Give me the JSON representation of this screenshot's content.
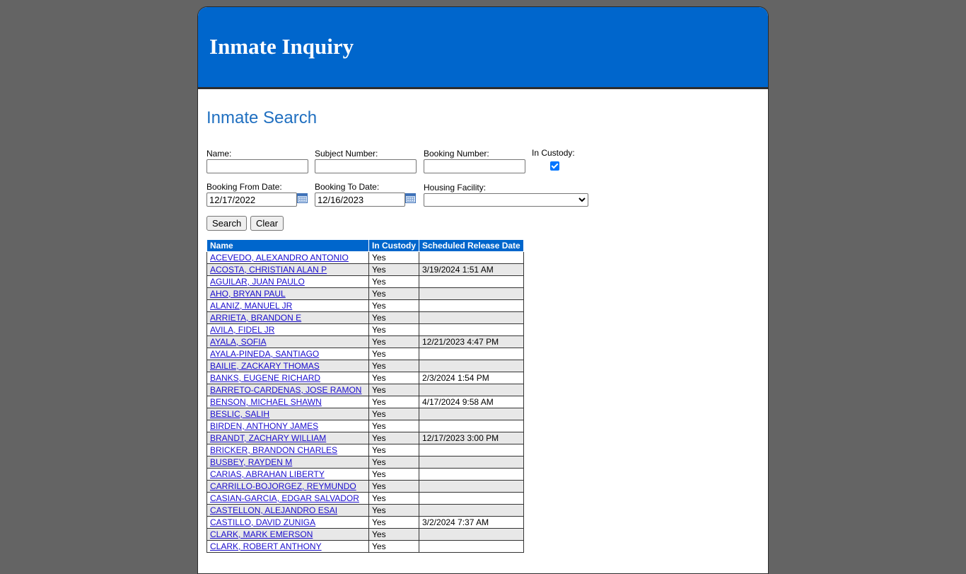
{
  "header": {
    "title": "Inmate Inquiry"
  },
  "page": {
    "title": "Inmate Search"
  },
  "form": {
    "name_label": "Name:",
    "name_value": "",
    "subject_label": "Subject Number:",
    "subject_value": "",
    "booking_label": "Booking Number:",
    "booking_value": "",
    "custody_label": "In Custody:",
    "custody_checked": true,
    "from_label": "Booking From Date:",
    "from_value": "12/17/2022",
    "to_label": "Booking To Date:",
    "to_value": "12/16/2023",
    "facility_label": "Housing Facility:",
    "facility_value": "",
    "search_button": "Search",
    "clear_button": "Clear"
  },
  "table": {
    "headers": [
      "Name",
      "In Custody",
      "Scheduled Release Date"
    ],
    "rows": [
      [
        "ACEVEDO, ALEXANDRO ANTONIO",
        "Yes",
        ""
      ],
      [
        "ACOSTA, CHRISTIAN ALAN P",
        "Yes",
        "3/19/2024 1:51 AM"
      ],
      [
        "AGUILAR, JUAN PAULO",
        "Yes",
        ""
      ],
      [
        "AHO, BRYAN PAUL",
        "Yes",
        ""
      ],
      [
        "ALANIZ, MANUEL JR",
        "Yes",
        ""
      ],
      [
        "ARRIETA, BRANDON E",
        "Yes",
        ""
      ],
      [
        "AVILA, FIDEL JR",
        "Yes",
        ""
      ],
      [
        "AYALA, SOFIA",
        "Yes",
        "12/21/2023 4:47 PM"
      ],
      [
        "AYALA-PINEDA, SANTIAGO",
        "Yes",
        ""
      ],
      [
        "BAILIE, ZACKARY THOMAS",
        "Yes",
        ""
      ],
      [
        "BANKS, EUGENE RICHARD",
        "Yes",
        "2/3/2024 1:54 PM"
      ],
      [
        "BARRETO-CARDENAS, JOSE RAMON",
        "Yes",
        ""
      ],
      [
        "BENSON, MICHAEL SHAWN",
        "Yes",
        "4/17/2024 9:58 AM"
      ],
      [
        "BESLIC, SALIH",
        "Yes",
        ""
      ],
      [
        "BIRDEN, ANTHONY JAMES",
        "Yes",
        ""
      ],
      [
        "BRANDT, ZACHARY WILLIAM",
        "Yes",
        "12/17/2023 3:00 PM"
      ],
      [
        "BRICKER, BRANDON CHARLES",
        "Yes",
        ""
      ],
      [
        "BUSBEY, RAYDEN M",
        "Yes",
        ""
      ],
      [
        "CARIAS, ABRAHAN LIBERTY",
        "Yes",
        ""
      ],
      [
        "CARRILLO-BOJORGEZ, REYMUNDO",
        "Yes",
        ""
      ],
      [
        "CASIAN-GARCIA, EDGAR SALVADOR",
        "Yes",
        ""
      ],
      [
        "CASTELLON, ALEJANDRO ESAI",
        "Yes",
        ""
      ],
      [
        "CASTILLO, DAVID ZUNIGA",
        "Yes",
        "3/2/2024 7:37 AM"
      ],
      [
        "CLARK, MARK EMERSON",
        "Yes",
        ""
      ],
      [
        "CLARK, ROBERT ANTHONY",
        "Yes",
        ""
      ]
    ]
  }
}
